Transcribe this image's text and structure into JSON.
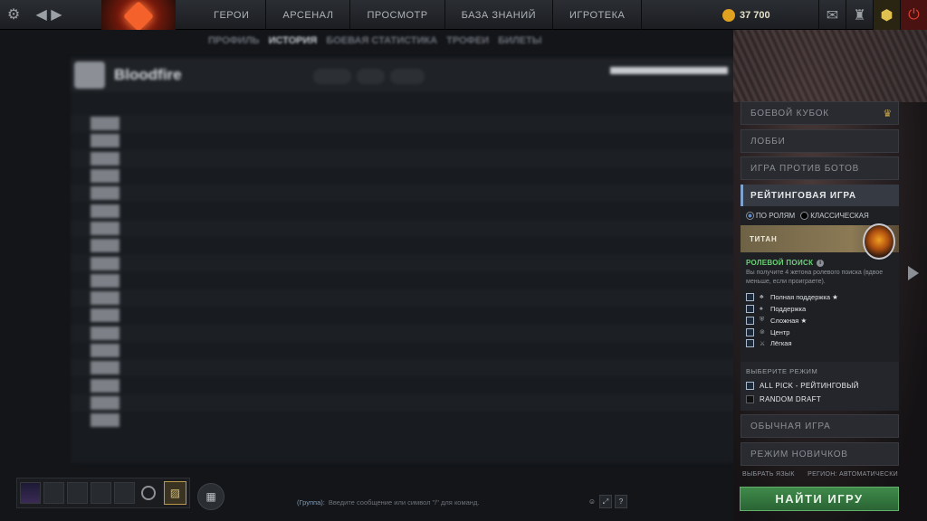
{
  "topbar": {
    "nav": [
      "ГЕРОИ",
      "АРСЕНАЛ",
      "ПРОСМОТР",
      "БАЗА ЗНАНИЙ",
      "ИГРОТЕКА"
    ],
    "shards": "37 700",
    "icons": [
      "gear-icon",
      "back-forward-icon",
      "dota-logo",
      "mail-icon",
      "hero-icon",
      "rank-badge-icon",
      "power-icon"
    ]
  },
  "profile": {
    "subnav": [
      "ПРОФИЛЬ",
      "ИСТОРИЯ",
      "БОЕВАЯ СТАТИСТИКА",
      "ТРОФЕИ",
      "БИЛЕТЫ"
    ],
    "player_name": "Bloodfire"
  },
  "right": {
    "menu": {
      "battle_cup": "БОЕВОЙ КУБОК",
      "lobby": "ЛОББИ",
      "vs_bots": "ИГРА ПРОТИВ БОТОВ",
      "ranked": "РЕЙТИНГОВАЯ ИГРА",
      "normal": "ОБЫЧНАЯ ИГРА",
      "newbie": "РЕЖИМ НОВИЧКОВ"
    },
    "ranked": {
      "by_roles": "ПО РОЛЯМ",
      "classic": "КЛАССИЧЕСКАЯ",
      "rank_name": "ТИТАН",
      "role_search_title": "РОЛЕВОЙ ПОИСК",
      "role_search_desc": "Вы получите 4 жетона ролевого поиска (вдвое меньше, если проиграете).",
      "roles": [
        {
          "label": "Полная поддержка ★",
          "icon": "hard-support-icon"
        },
        {
          "label": "Поддержка",
          "icon": "support-icon"
        },
        {
          "label": "Сложная ★",
          "icon": "offlane-icon"
        },
        {
          "label": "Центр",
          "icon": "mid-icon"
        },
        {
          "label": "Лёгкая",
          "icon": "safelane-icon"
        }
      ],
      "mode_title": "ВЫБЕРИТЕ РЕЖИМ",
      "modes": [
        "ALL PICK - РЕЙТИНГОВЫЙ",
        "RANDOM DRAFT"
      ]
    },
    "language": "ВЫБРАТЬ ЯЗЫК",
    "region": "РЕГИОН: АВТОМАТИЧЕСКИ",
    "find_game": "НАЙТИ ИГРУ"
  },
  "chat": {
    "group": "(Группа):",
    "placeholder": "Введите сообщение или символ \"/\" для команд."
  }
}
